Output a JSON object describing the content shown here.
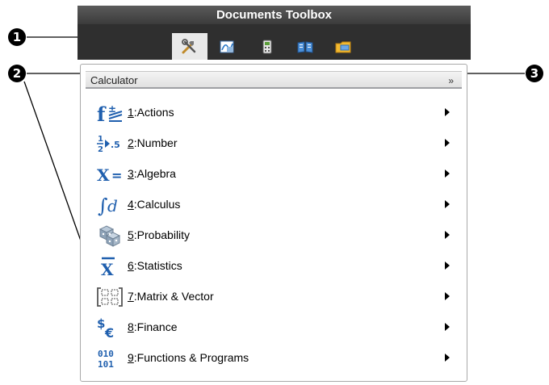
{
  "toolbox": {
    "title": "Documents Toolbox",
    "tabs": [
      {
        "icon": "tools-icon",
        "active": true
      },
      {
        "icon": "graph-icon",
        "active": false
      },
      {
        "icon": "calculator-icon",
        "active": false
      },
      {
        "icon": "book-icon",
        "active": false
      },
      {
        "icon": "folder-icon",
        "active": false
      }
    ]
  },
  "panel": {
    "header": "Calculator",
    "collapse_icon": "double-chevron-up-icon",
    "items": [
      {
        "num": "1",
        "label": ":Actions",
        "icon": "function-actions-icon"
      },
      {
        "num": "2",
        "label": ":Number",
        "icon": "fraction-number-icon"
      },
      {
        "num": "3",
        "label": ":Algebra",
        "icon": "algebra-x-equals-icon"
      },
      {
        "num": "4",
        "label": ":Calculus",
        "icon": "integral-icon"
      },
      {
        "num": "5",
        "label": ":Probability",
        "icon": "dice-icon"
      },
      {
        "num": "6",
        "label": ":Statistics",
        "icon": "x-bar-icon"
      },
      {
        "num": "7",
        "label": ":Matrix & Vector",
        "icon": "matrix-icon"
      },
      {
        "num": "8",
        "label": ":Finance",
        "icon": "currency-icon"
      },
      {
        "num": "9",
        "label": ":Functions & Programs",
        "icon": "binary-icon"
      }
    ]
  },
  "callouts": [
    "➊",
    "➋",
    "➌"
  ]
}
